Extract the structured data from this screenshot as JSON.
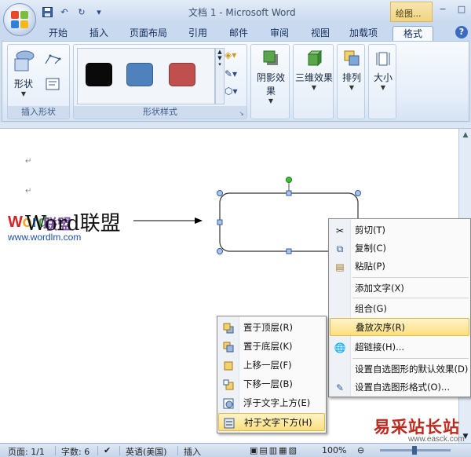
{
  "window": {
    "title": "文档 1 - Microsoft Word",
    "context_tab": "绘图...",
    "controls": [
      "−",
      "□",
      "×"
    ]
  },
  "tabs": [
    {
      "label": "开始",
      "active": false
    },
    {
      "label": "插入",
      "active": false
    },
    {
      "label": "页面布局",
      "active": false
    },
    {
      "label": "引用",
      "active": false
    },
    {
      "label": "邮件",
      "active": false
    },
    {
      "label": "审阅",
      "active": false
    },
    {
      "label": "视图",
      "active": false
    },
    {
      "label": "加载项",
      "active": false
    },
    {
      "label": "格式",
      "active": true
    }
  ],
  "ribbon": {
    "insert_shapes": {
      "button": "形状",
      "group_label": "插入形状"
    },
    "shape_styles": {
      "group_label": "形状样式",
      "swatches": [
        "#0a0a0a",
        "#4f81bd",
        "#c0504d"
      ]
    },
    "shadow_effects": {
      "label": "阴影效果"
    },
    "three_d": {
      "label": "三维效果"
    },
    "arrange": {
      "label": "排列"
    },
    "size": {
      "label": "大小"
    }
  },
  "document": {
    "heading": "Word联盟",
    "logo_letters": [
      "W",
      "o",
      "r",
      "d"
    ],
    "logo_suffix": "联盟",
    "logo_url": "www.wordlm.com"
  },
  "context_menu": {
    "items": [
      {
        "label": "剪切(T)",
        "icon": "scissors-icon",
        "glyph": "✂"
      },
      {
        "label": "复制(C)",
        "icon": "copy-icon",
        "glyph": "⧉"
      },
      {
        "label": "粘贴(P)",
        "icon": "paste-icon",
        "glyph": "📋"
      },
      {
        "label": "添加文字(X)",
        "icon": "",
        "glyph": ""
      },
      {
        "label": "组合(G)",
        "icon": "",
        "glyph": ""
      },
      {
        "label": "叠放次序(R)",
        "icon": "",
        "glyph": "",
        "highlighted": true,
        "submenu": true
      },
      {
        "label": "超链接(H)...",
        "icon": "hyperlink-icon",
        "glyph": "🌐"
      },
      {
        "label": "设置自选图形的默认效果(D)",
        "icon": "",
        "glyph": ""
      },
      {
        "label": "设置自选图形格式(O)...",
        "icon": "format-shape-icon",
        "glyph": "✎"
      }
    ]
  },
  "order_submenu": {
    "items": [
      {
        "label": "置于顶层(R)",
        "icon": "bring-to-front-icon"
      },
      {
        "label": "置于底层(K)",
        "icon": "send-to-back-icon"
      },
      {
        "label": "上移一层(F)",
        "icon": "bring-forward-icon"
      },
      {
        "label": "下移一层(B)",
        "icon": "send-backward-icon"
      },
      {
        "label": "浮于文字上方(E)",
        "icon": "in-front-of-text-icon"
      },
      {
        "label": "衬于文字下方(H)",
        "icon": "behind-text-icon",
        "highlighted": true
      }
    ]
  },
  "statusbar": {
    "page": "页面: 1/1",
    "words": "字数: 6",
    "language": "英语(美国)",
    "mode": "插入",
    "zoom": "100%"
  },
  "watermark": {
    "text": "易采站长站",
    "url": "www.easck.com"
  }
}
